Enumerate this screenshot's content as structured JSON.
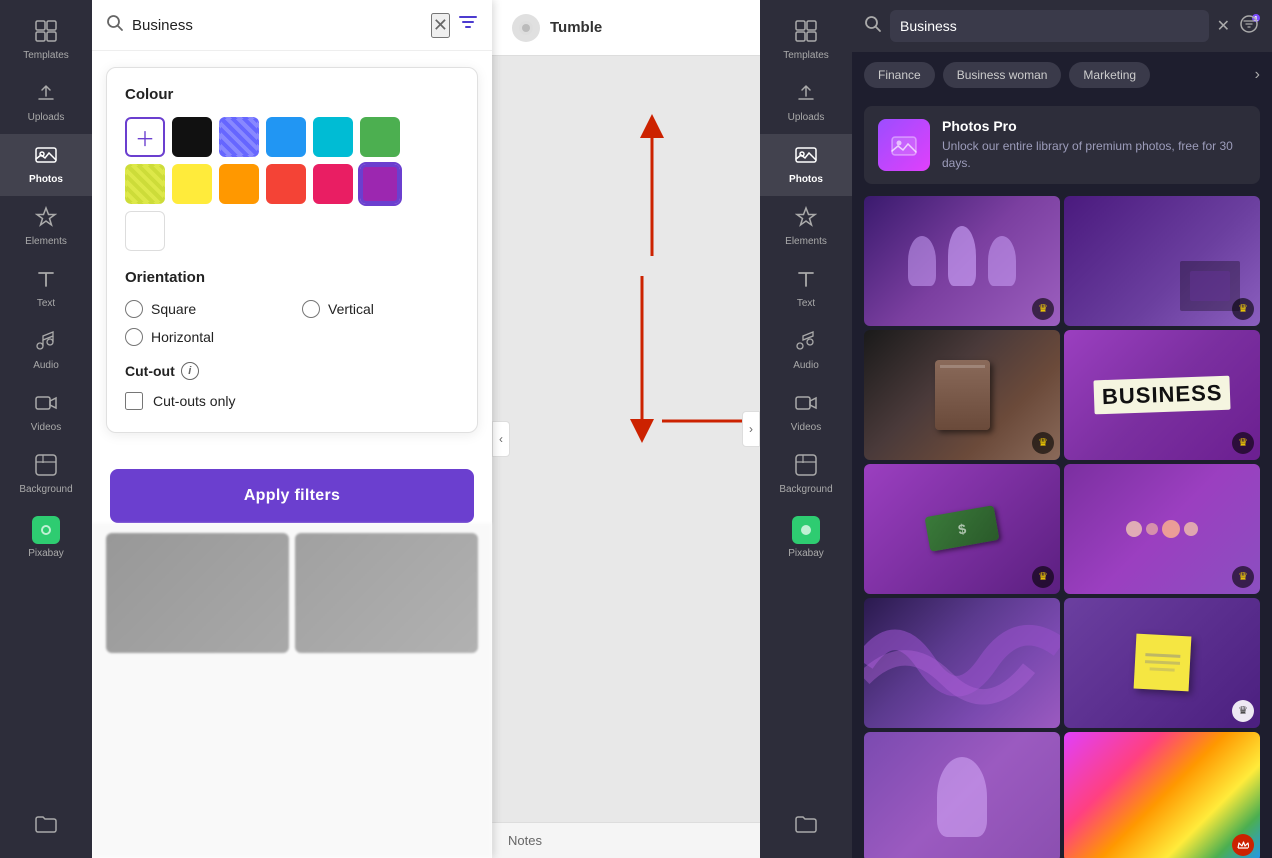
{
  "leftSidebar": {
    "items": [
      {
        "id": "templates",
        "label": "Templates",
        "icon": "⊞"
      },
      {
        "id": "uploads",
        "label": "Uploads",
        "icon": "↑"
      },
      {
        "id": "photos",
        "label": "Photos",
        "icon": "🖼"
      },
      {
        "id": "elements",
        "label": "Elements",
        "icon": "♡△"
      },
      {
        "id": "text",
        "label": "Text",
        "icon": "T"
      },
      {
        "id": "audio",
        "label": "Audio",
        "icon": "♪"
      },
      {
        "id": "videos",
        "label": "Videos",
        "icon": "▶"
      },
      {
        "id": "background",
        "label": "Background",
        "icon": "⊘"
      },
      {
        "id": "pixabay",
        "label": "Pixabay",
        "icon": "📷"
      }
    ],
    "activeItem": "photos"
  },
  "filterPanel": {
    "searchValue": "Business",
    "searchPlaceholder": "Search",
    "clearLabel": "✕",
    "filterIconLabel": "⊟",
    "colour": {
      "title": "Colour",
      "swatches": [
        {
          "color": "#fff",
          "type": "add",
          "label": "+"
        },
        {
          "color": "#111111",
          "type": "solid"
        },
        {
          "color": "#6666ff",
          "type": "pattern"
        },
        {
          "color": "#2196f3",
          "type": "solid"
        },
        {
          "color": "#00bcd4",
          "type": "solid"
        },
        {
          "color": "#4caf50",
          "type": "solid"
        },
        {
          "color": "#cddc39",
          "type": "pattern"
        },
        {
          "color": "#ffeb3b",
          "type": "solid"
        },
        {
          "color": "#ff9800",
          "type": "solid"
        },
        {
          "color": "#f44336",
          "type": "solid"
        },
        {
          "color": "#e91e63",
          "type": "solid"
        },
        {
          "color": "#9c27b0",
          "type": "solid",
          "selected": true
        },
        {
          "color": "#ffffff",
          "type": "solid"
        }
      ]
    },
    "orientation": {
      "title": "Orientation",
      "options": [
        {
          "id": "square",
          "label": "Square"
        },
        {
          "id": "vertical",
          "label": "Vertical"
        },
        {
          "id": "horizontal",
          "label": "Horizontal"
        }
      ],
      "selected": null
    },
    "cutout": {
      "title": "Cut-out",
      "checkboxLabel": "Cut-outs only",
      "checked": false
    },
    "applyButton": "Apply filters"
  },
  "canvas": {
    "title": "Tumble",
    "notesLabel": "Notes"
  },
  "rightSidebar": {
    "items": [
      {
        "id": "templates",
        "label": "Templates",
        "icon": "⊞"
      },
      {
        "id": "uploads",
        "label": "Uploads",
        "icon": "↑"
      },
      {
        "id": "photos",
        "label": "Photos",
        "icon": "🖼"
      },
      {
        "id": "elements",
        "label": "Elements",
        "icon": "♡△"
      },
      {
        "id": "text",
        "label": "Text",
        "icon": "T"
      },
      {
        "id": "audio",
        "label": "Audio",
        "icon": "♪"
      },
      {
        "id": "videos",
        "label": "Videos",
        "icon": "▶"
      },
      {
        "id": "background",
        "label": "Background",
        "icon": "⊘"
      },
      {
        "id": "pixabay",
        "label": "Pixabay",
        "icon": "📷"
      }
    ],
    "activeItem": "photos"
  },
  "rightPanel": {
    "searchValue": "Business",
    "searchPlaceholder": "Search",
    "notificationCount": 1,
    "tags": [
      {
        "label": "Finance"
      },
      {
        "label": "Business woman"
      },
      {
        "label": "Marketing"
      }
    ],
    "proSection": {
      "title": "Photos Pro",
      "description": "Unlock our entire library of premium photos, free for 30 days."
    },
    "photos": [
      {
        "id": 1,
        "type": "purple-lights",
        "hasCrown": true,
        "crownStyle": "dark"
      },
      {
        "id": 2,
        "type": "purple-office",
        "hasCrown": true,
        "crownStyle": "dark"
      },
      {
        "id": 3,
        "type": "matchbook",
        "hasCrown": true,
        "crownStyle": "dark"
      },
      {
        "id": 4,
        "type": "business-text",
        "hasCrown": true,
        "crownStyle": "dark"
      },
      {
        "id": 5,
        "type": "money",
        "hasCrown": true,
        "crownStyle": "dark"
      },
      {
        "id": 6,
        "type": "jewelry",
        "hasCrown": true,
        "crownStyle": "dark"
      },
      {
        "id": 7,
        "type": "brush",
        "hasCrown": false
      },
      {
        "id": 8,
        "type": "yellow-note",
        "hasCrown": true,
        "crownStyle": "light"
      },
      {
        "id": 9,
        "type": "purple-light2",
        "hasCrown": false
      },
      {
        "id": 10,
        "type": "colorful",
        "hasCrown": true,
        "crownStyle": "red"
      }
    ]
  }
}
